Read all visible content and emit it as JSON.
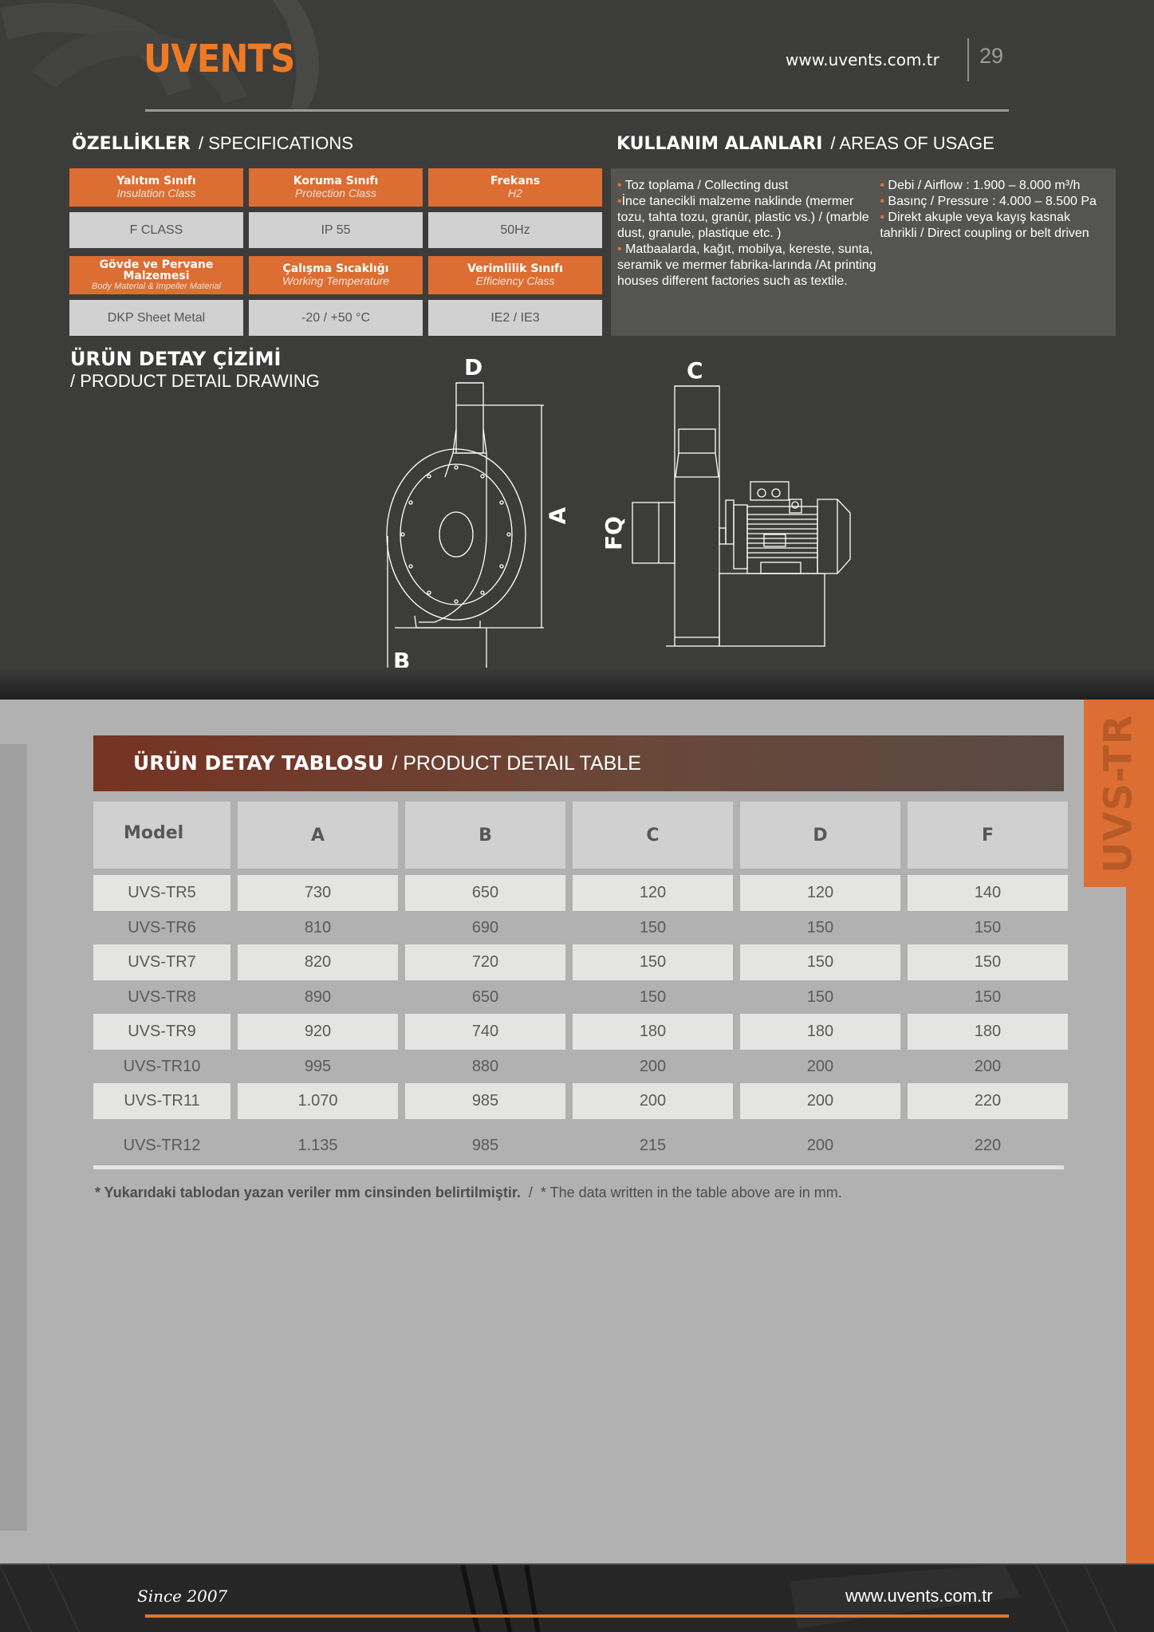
{
  "header": {
    "logo": "UVENTS",
    "url": "www.uvents.com.tr",
    "page_number": "29"
  },
  "specifications": {
    "title_tr": "ÖZELLİKLER",
    "title_en": "SPECIFICATIONS",
    "items": [
      {
        "label_tr": "Yalıtım Sınıfı",
        "label_en": "Insulation Class",
        "value": "F CLASS"
      },
      {
        "label_tr": "Koruma Sınıfı",
        "label_en": "Protection Class",
        "value": "IP 55"
      },
      {
        "label_tr": "Frekans",
        "label_en": "H2",
        "value": "50Hz"
      },
      {
        "label_tr": "Gövde ve Pervane Malzemesi",
        "label_en": "Body Material & Impeller Material",
        "value": "DKP Sheet Metal"
      },
      {
        "label_tr": "Çalışma Sıcaklığı",
        "label_en": "Working Temperature",
        "value": "-20 / +50 °C"
      },
      {
        "label_tr": "Verimlilik Sınıfı",
        "label_en": "Efficiency Class",
        "value": "IE2 / IE3"
      }
    ]
  },
  "usage": {
    "title_tr": "KULLANIM ALANLARI",
    "title_en": "AREAS OF USAGE",
    "col1": [
      "Toz toplama / Collecting dust",
      "İnce tanecikli malzeme naklinde (mermer tozu, tahta tozu, granür, plastic vs.) / (marble dust, granule, plastique etc. )",
      "Matbaalarda, kağıt, mobilya, kereste, sunta, seramik ve mermer fabrika-larında /At printing houses different factories such as textile."
    ],
    "col2": [
      "Debi / Airflow : 1.900 – 8.000 m³/h",
      "Basınç / Pressure : 4.000 – 8.500 Pa",
      "Direkt akuple veya kayış kasnak tahrikli / Direct coupling or belt driven"
    ],
    "bullet": "•"
  },
  "drawing": {
    "title_tr": "ÜRÜN DETAY ÇİZİMİ",
    "title_en": "/ PRODUCT DETAIL DRAWING",
    "labels": {
      "a": "A",
      "b": "B",
      "c": "C",
      "d": "D",
      "fq": "FQ"
    }
  },
  "side_tab": {
    "label": "UVS-TR"
  },
  "product_table": {
    "title_tr": "ÜRÜN DETAY TABLOSU",
    "title_en": "PRODUCT DETAIL TABLE",
    "columns": [
      "Model",
      "A",
      "B",
      "C",
      "D",
      "F"
    ],
    "rows": [
      [
        "UVS-TR5",
        "730",
        "650",
        "120",
        "120",
        "140"
      ],
      [
        "UVS-TR6",
        "810",
        "690",
        "150",
        "150",
        "150"
      ],
      [
        "UVS-TR7",
        "820",
        "720",
        "150",
        "150",
        "150"
      ],
      [
        "UVS-TR8",
        "890",
        "650",
        "150",
        "150",
        "150"
      ],
      [
        "UVS-TR9",
        "920",
        "740",
        "180",
        "180",
        "180"
      ],
      [
        "UVS-TR10",
        "995",
        "880",
        "200",
        "200",
        "200"
      ],
      [
        "UVS-TR11",
        "1.070",
        "985",
        "200",
        "200",
        "220"
      ],
      [
        "UVS-TR12",
        "1.135",
        "985",
        "215",
        "200",
        "220"
      ]
    ],
    "footnote_tr": "* Yukarıdaki tablodan yazan veriler mm cinsinden belirtilmiştir.",
    "footnote_en": "* The data written in the table above are in mm."
  },
  "footer": {
    "since": "Since 2007",
    "url": "www.uvents.com.tr"
  },
  "colors": {
    "accent_orange": "#dc6e33",
    "logo_orange": "#ef7a23",
    "dark_bg": "#3c3c3b",
    "gray_bg": "#b1b1b1",
    "banner_red": "#763322"
  }
}
